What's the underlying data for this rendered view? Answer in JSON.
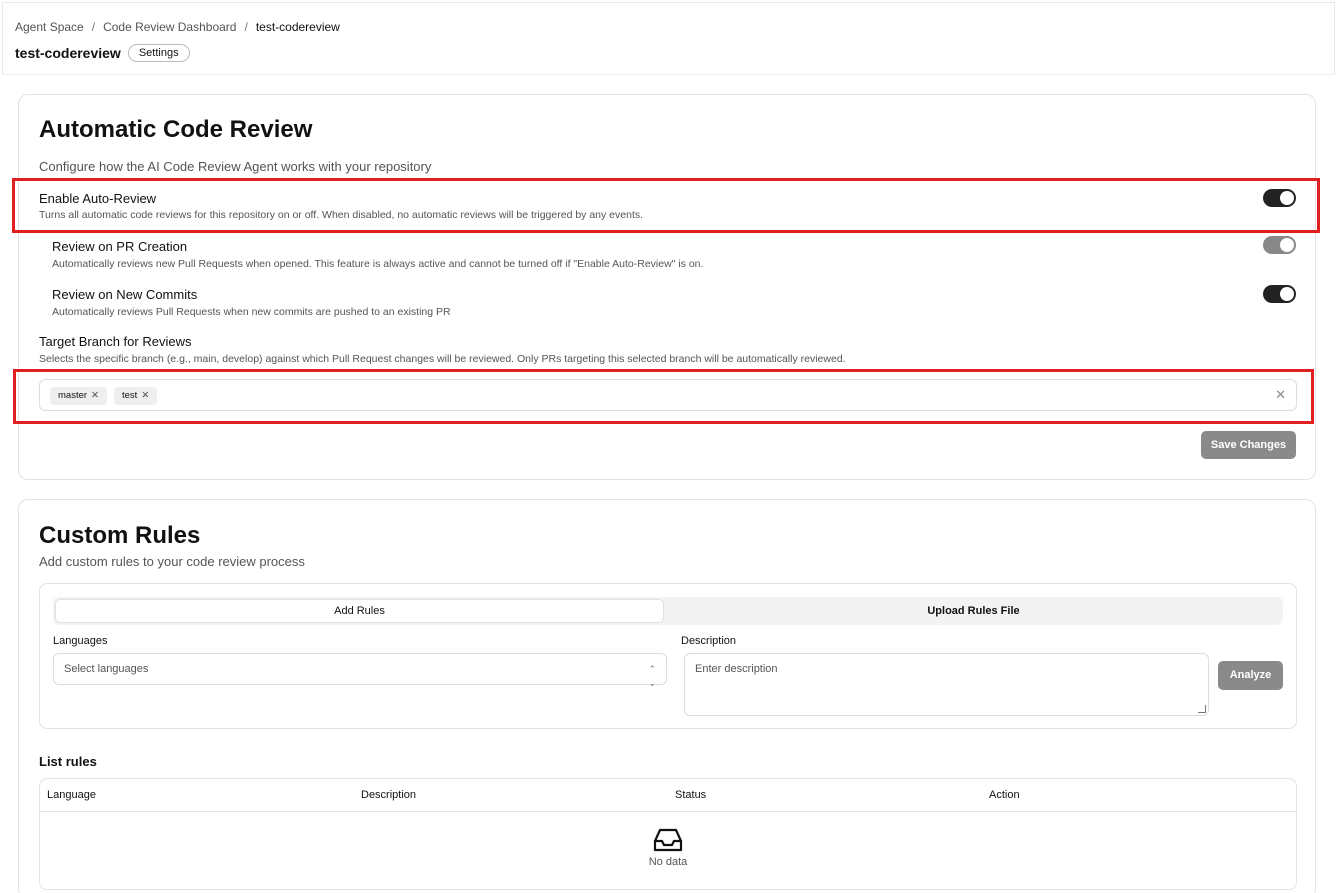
{
  "breadcrumb": {
    "items": [
      "Agent Space",
      "Code Review Dashboard",
      "test-codereview"
    ],
    "separator": "/"
  },
  "header": {
    "title": "test-codereview",
    "badge": "Settings"
  },
  "auto_review": {
    "title": "Automatic Code Review",
    "subtitle": "Configure how the AI Code Review Agent works with your repository",
    "options": [
      {
        "label": "Enable Auto-Review",
        "description": "Turns all automatic code reviews for this repository on or off. When disabled, no automatic reviews will be triggered by any events.",
        "enabled": true
      },
      {
        "label": "Review on PR Creation",
        "description": "Automatically reviews new Pull Requests when opened. This feature is always active and cannot be turned off if \"Enable Auto-Review\" is on.",
        "enabled": true
      },
      {
        "label": "Review on New Commits",
        "description": "Automatically reviews Pull Requests when new commits are pushed to an existing PR",
        "enabled": true
      }
    ],
    "target_branch": {
      "label": "Target Branch for Reviews",
      "description": "Selects the specific branch (e.g., main, develop) against which Pull Request changes will be reviewed. Only PRs targeting this selected branch will be automatically reviewed.",
      "branches": [
        "master",
        "test"
      ]
    },
    "save_label": "Save Changes"
  },
  "custom_rules": {
    "title": "Custom Rules",
    "subtitle": "Add custom rules to your code review process",
    "tabs": [
      "Add Rules",
      "Upload Rules File"
    ],
    "languages_label": "Languages",
    "languages_placeholder": "Select languages",
    "description_label": "Description",
    "description_placeholder": "Enter description",
    "analyze_label": "Analyze",
    "list_title": "List rules",
    "columns": [
      "Language",
      "Description",
      "Status",
      "Action"
    ],
    "empty_text": "No data"
  },
  "colors": {
    "highlight": "#e02020",
    "toggle_on": "#222222",
    "toggle_disabled": "#888888",
    "button_disabled": "#8a8a8a"
  },
  "icons": {
    "clear": "close-icon",
    "chevron": "chevron-updown-icon",
    "empty": "inbox-icon"
  }
}
